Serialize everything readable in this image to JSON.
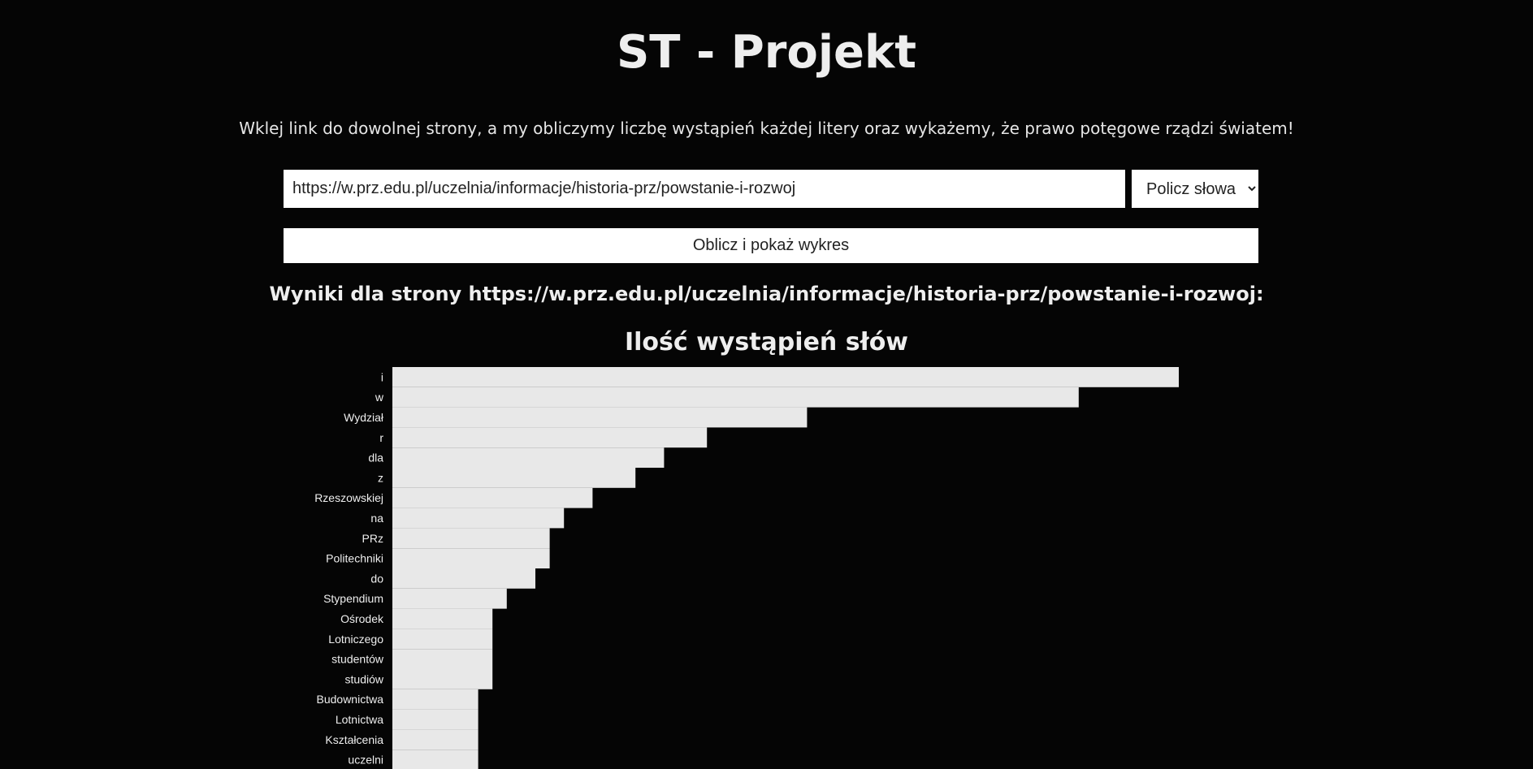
{
  "header": {
    "title": "ST - Projekt",
    "subtitle": "Wklej link do dowolnej strony, a my obliczymy liczbę wystąpień każdej litery oraz wykażemy, że prawo potęgowe rządzi światem!"
  },
  "form": {
    "url_value": "https://w.prz.edu.pl/uczelnia/informacje/historia-prz/powstanie-i-rozwoj",
    "mode_selected": "Policz słowa",
    "compute_label": "Oblicz i pokaż wykres"
  },
  "results": {
    "heading": "Wyniki dla strony https://w.prz.edu.pl/uczelnia/informacje/historia-prz/powstanie-i-rozwoj:"
  },
  "chart_data": {
    "type": "bar",
    "orientation": "horizontal",
    "title": "Ilość wystąpień słów",
    "bar_color": "#e8e8e8",
    "categories": [
      "i",
      "w",
      "Wydział",
      "r",
      "dla",
      "z",
      "Rzeszowskiej",
      "na",
      "PRz",
      "Politechniki",
      "do",
      "Stypendium",
      "Ośrodek",
      "Lotniczego",
      "studentów",
      "studiów",
      "Budownictwa",
      "Lotnictwa",
      "Kształcenia",
      "uczelni"
    ],
    "values": [
      55,
      48,
      29,
      22,
      19,
      17,
      14,
      12,
      11,
      11,
      10,
      8,
      7,
      7,
      7,
      7,
      6,
      6,
      6,
      6
    ],
    "xlim": [
      0,
      55
    ]
  }
}
